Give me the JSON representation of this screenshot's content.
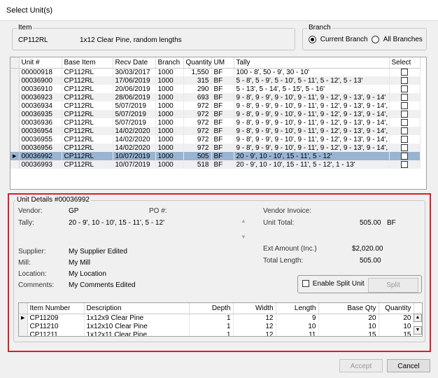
{
  "window": {
    "title": "Select Unit(s)"
  },
  "item_group": {
    "legend": "Item",
    "code": "CP112RL",
    "description": "1x12 Clear Pine, random lengths"
  },
  "branch_group": {
    "legend": "Branch",
    "current": "Current Branch",
    "all": "All Branches",
    "selected": "current"
  },
  "units_table": {
    "columns": [
      "Unit #",
      "Base Item",
      "Recv Date",
      "Branch",
      "Quantity",
      "UM",
      "Tally",
      "Select"
    ],
    "rows": [
      [
        "00000918",
        "CP112RL",
        "30/03/2017",
        "1000",
        "1,550",
        "BF",
        "100 - 8', 50 - 9', 30 - 10'"
      ],
      [
        "00036900",
        "CP112RL",
        "17/06/2019",
        "1000",
        "315",
        "BF",
        "5 - 8', 5 - 9', 5 - 10', 5 - 11', 5 - 12', 5 - 13'"
      ],
      [
        "00036910",
        "CP112RL",
        "20/06/2019",
        "1000",
        "290",
        "BF",
        "5 - 13', 5 - 14', 5 - 15', 5 - 16'"
      ],
      [
        "00036923",
        "CP112RL",
        "28/06/2019",
        "1000",
        "693",
        "BF",
        "9 - 8', 9 - 9', 9 - 10', 9 - 11', 9 - 12', 9 - 13', 9 - 14'"
      ],
      [
        "00036934",
        "CP112RL",
        "5/07/2019",
        "1000",
        "972",
        "BF",
        "9 - 8', 9 - 9', 9 - 10', 9 - 11', 9 - 12', 9 - 13', 9 - 14', 9 -"
      ],
      [
        "00036935",
        "CP112RL",
        "5/07/2019",
        "1000",
        "972",
        "BF",
        "9 - 8', 9 - 9', 9 - 10', 9 - 11', 9 - 12', 9 - 13', 9 - 14', 9 -"
      ],
      [
        "00036936",
        "CP112RL",
        "5/07/2019",
        "1000",
        "972",
        "BF",
        "9 - 8', 9 - 9', 9 - 10', 9 - 11', 9 - 12', 9 - 13', 9 - 14', 9 -"
      ],
      [
        "00036954",
        "CP112RL",
        "14/02/2020",
        "1000",
        "972",
        "BF",
        "9 - 8', 9 - 9', 9 - 10', 9 - 11', 9 - 12', 9 - 13', 9 - 14', 9 -"
      ],
      [
        "00036955",
        "CP112RL",
        "14/02/2020",
        "1000",
        "972",
        "BF",
        "9 - 8', 9 - 9', 9 - 10', 9 - 11', 9 - 12', 9 - 13', 9 - 14', 9 -"
      ],
      [
        "00036956",
        "CP112RL",
        "14/02/2020",
        "1000",
        "972",
        "BF",
        "9 - 8', 9 - 9', 9 - 10', 9 - 11', 9 - 12', 9 - 13', 9 - 14', 9 -"
      ],
      [
        "00036992",
        "CP112RL",
        "10/07/2019",
        "1000",
        "505",
        "BF",
        "20 - 9', 10 - 10', 15 - 11', 5 - 12'"
      ],
      [
        "00036993",
        "CP112RL",
        "10/07/2019",
        "1000",
        "518",
        "BF",
        "20 - 9', 10 - 10', 15 - 11', 5 - 12', 1 - 13'"
      ]
    ],
    "selected_row": 10
  },
  "unit_details": {
    "legend": "Unit Details #00036992",
    "vendor_label": "Vendor:",
    "vendor": "GP",
    "po_label": "PO #:",
    "tally_label": "Tally:",
    "tally": "20 - 9', 10 - 10', 15 - 11', 5 - 12'",
    "vendor_invoice_label": "Vendor Invoice:",
    "unit_total_label": "Unit Total:",
    "unit_total": "505.00",
    "unit_total_um": "BF",
    "supplier_label": "Supplier:",
    "supplier": "My Supplier Edited",
    "mill_label": "Mill:",
    "mill": "My Mill",
    "location_label": "Location:",
    "location": "My Location",
    "comments_label": "Comments:",
    "comments": "My Comments Edited",
    "ext_amount_label": "Ext Amount (Inc.)",
    "ext_amount": "$2,020.00",
    "total_length_label": "Total Length:",
    "total_length": "505.00",
    "split_checkbox_label": "Enable Split Unit",
    "split_button": "Split"
  },
  "items_table": {
    "columns": [
      "Item Number",
      "Description",
      "Depth",
      "Width",
      "Length",
      "Base Qty",
      "Quantity"
    ],
    "rows": [
      [
        "CP11209",
        "1x12x9 Clear Pine",
        "1",
        "12",
        "9",
        "20",
        "20"
      ],
      [
        "CP11210",
        "1x12x10 Clear Pine",
        "1",
        "12",
        "10",
        "10",
        "10"
      ],
      [
        "CP11211",
        "1x12x11 Clear Pine",
        "1",
        "12",
        "11",
        "15",
        "15"
      ]
    ]
  },
  "footer": {
    "accept": "Accept",
    "cancel": "Cancel"
  },
  "colors": {
    "highlight_border": "#d91f26",
    "selected_row": "#99b4d1"
  }
}
